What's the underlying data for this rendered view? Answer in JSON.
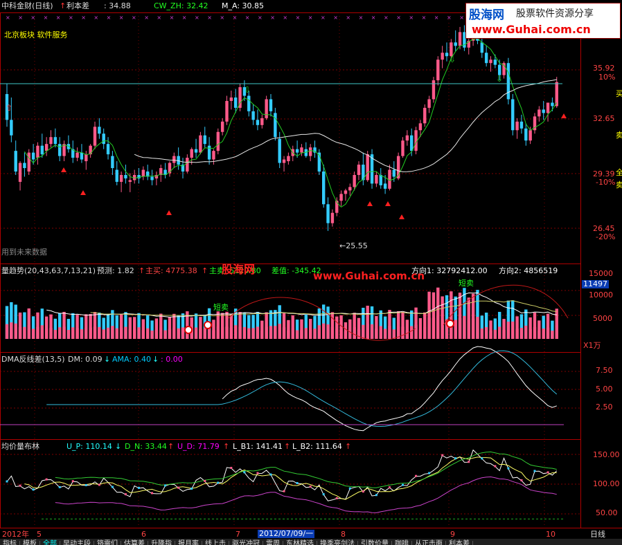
{
  "header": {
    "stock": "中科金财(日线)",
    "arrow": "↑",
    "indicator_name": "利本差",
    "val1_label": ": 34.88",
    "cw_label": "CW_ZH: 32.42",
    "ma_label": "M_A: 30.85",
    "subtitle": "北京板块 软件服务",
    "future_note": "用到未来数据"
  },
  "watermark": {
    "logo_cn": "股海网",
    "logo_tag": "股票软件资源分享",
    "logo_url": "www.Guhai.com.cn",
    "mid_cn": "股海网",
    "mid_url": "www.Guhai.com.cn"
  },
  "price_axis": {
    "ticks": [
      "35.92",
      "10%",
      "32.65",
      "29.39",
      "-10%",
      "26.45",
      "-20%"
    ],
    "low_marker": "←25.55",
    "side_chars": [
      "买",
      "卖",
      "全",
      "卖"
    ]
  },
  "vol_panel": {
    "title": "量趋势(20,43,63,7,13,21)",
    "forecast": "预测: 1.82",
    "up1": "↑",
    "main_buy": "主买: 4775.38",
    "up2": "↑",
    "main_sell": "主卖: 5120.80",
    "diff": "差值: -345.42",
    "dir1": "方向1: 32792412.00",
    "dir2": "方向2: 4856519",
    "ticks": [
      "15000",
      "10000",
      "5000"
    ],
    "current": "11497",
    "unit": "X1万",
    "signal1": "短卖",
    "signal2": "短卖"
  },
  "dma_panel": {
    "title": "DMA反线差(13,5)",
    "dm": "DM: 0.09",
    "dm_arrow": "↓",
    "ama": "AMA: 0.40",
    "ama_arrow": "↓",
    "third": ": 0.00",
    "ticks": [
      "7.50",
      "5.00",
      "2.50"
    ]
  },
  "boll_panel": {
    "title": "均价量布林",
    "up": "U_P: 110.14",
    "up_arrow": "↓",
    "dn": "D_N: 33.44",
    "dn_arrow": "↑",
    "ud": "U_D: 71.79",
    "ud_arrow": "↑",
    "lb1": "L_B1: 141.41",
    "lb1_arrow": "↑",
    "lb2": "L_B2: 111.64",
    "lb2_arrow": "↑",
    "ticks": [
      "150.00",
      "100.00",
      "50.00"
    ]
  },
  "date_axis": {
    "year": "2012年",
    "months": [
      "5",
      "6",
      "7",
      "8",
      "9",
      "10"
    ],
    "cursor_date": "2012/07/09/一",
    "period": "日线"
  },
  "tabs": [
    "指标",
    "模板",
    "全部",
    "早动主段",
    "铬需们",
    "估算差",
    "升降指",
    "报月率",
    "线上击",
    "驱光冲冠",
    "雷周",
    "东林精选",
    "换季亮剑法",
    "引数价量",
    "咖啡",
    "从正击面",
    "利本差"
  ],
  "colors": {
    "up": "#ff5a8a",
    "down": "#33ccff",
    "grid": "#800000",
    "axis": "#b00000"
  },
  "chart_data": {
    "type": "candlestick",
    "title": "中科金财(日线)",
    "ylim": [
      24.5,
      38.0
    ],
    "price_levels": [
      35.92,
      32.65,
      29.39,
      26.45
    ],
    "low_point": 25.55,
    "candles": [
      [
        33.5,
        34.1,
        31.6,
        32.0
      ],
      [
        32.0,
        33.3,
        30.7,
        31.1
      ],
      [
        30.2,
        30.8,
        28.8,
        29.0
      ],
      [
        28.4,
        29.6,
        27.9,
        29.5
      ],
      [
        29.5,
        30.1,
        28.7,
        29.2
      ],
      [
        29.0,
        30.3,
        28.8,
        30.1
      ],
      [
        30.1,
        30.6,
        29.4,
        29.7
      ],
      [
        29.8,
        30.7,
        29.4,
        30.5
      ],
      [
        30.5,
        31.2,
        29.8,
        30.0
      ],
      [
        30.2,
        31.0,
        29.9,
        30.6
      ],
      [
        30.6,
        31.4,
        30.4,
        31.0
      ],
      [
        31.0,
        31.5,
        30.4,
        30.6
      ],
      [
        30.6,
        31.0,
        29.6,
        29.9
      ],
      [
        29.9,
        30.8,
        29.6,
        30.6
      ],
      [
        30.6,
        31.1,
        30.1,
        30.3
      ],
      [
        30.3,
        30.8,
        29.5,
        29.8
      ],
      [
        29.8,
        30.4,
        29.6,
        30.1
      ],
      [
        30.1,
        30.6,
        29.5,
        29.7
      ],
      [
        29.6,
        30.2,
        29.1,
        30.0
      ],
      [
        30.0,
        30.6,
        29.8,
        30.5
      ],
      [
        30.5,
        31.9,
        30.3,
        31.6
      ],
      [
        31.6,
        32.1,
        30.9,
        31.2
      ],
      [
        31.2,
        31.5,
        30.3,
        30.6
      ],
      [
        30.6,
        31.0,
        29.7,
        30.0
      ],
      [
        29.9,
        30.2,
        28.8,
        29.2
      ],
      [
        29.1,
        29.6,
        28.2,
        28.4
      ],
      [
        28.4,
        29.0,
        27.8,
        28.8
      ],
      [
        28.8,
        29.4,
        28.3,
        28.6
      ],
      [
        28.4,
        28.9,
        27.8,
        28.5
      ],
      [
        28.5,
        29.1,
        28.3,
        28.8
      ],
      [
        28.8,
        29.2,
        28.3,
        28.6
      ],
      [
        28.7,
        29.3,
        28.5,
        29.1
      ],
      [
        29.0,
        29.4,
        28.5,
        28.7
      ],
      [
        28.7,
        29.1,
        28.2,
        28.5
      ],
      [
        28.6,
        29.0,
        28.2,
        28.8
      ],
      [
        28.8,
        29.4,
        28.4,
        29.2
      ],
      [
        29.1,
        29.5,
        28.6,
        28.8
      ],
      [
        28.9,
        29.6,
        28.7,
        29.5
      ],
      [
        29.5,
        30.1,
        29.2,
        29.9
      ],
      [
        29.9,
        30.4,
        29.1,
        29.4
      ],
      [
        29.4,
        29.8,
        28.6,
        29.0
      ],
      [
        29.0,
        30.0,
        28.9,
        29.8
      ],
      [
        29.8,
        30.4,
        29.4,
        30.3
      ],
      [
        30.3,
        30.9,
        29.8,
        30.1
      ],
      [
        30.1,
        31.3,
        30.0,
        31.1
      ],
      [
        31.1,
        31.6,
        30.4,
        30.6
      ],
      [
        30.5,
        31.0,
        29.4,
        29.7
      ],
      [
        29.7,
        30.3,
        29.4,
        30.2
      ],
      [
        30.2,
        31.5,
        30.0,
        31.3
      ],
      [
        31.3,
        32.1,
        31.1,
        31.9
      ],
      [
        31.9,
        33.4,
        31.7,
        33.1
      ],
      [
        33.1,
        33.7,
        32.6,
        33.3
      ],
      [
        33.3,
        33.8,
        32.4,
        32.7
      ],
      [
        32.7,
        34.1,
        32.5,
        33.9
      ],
      [
        33.9,
        34.3,
        33.1,
        33.4
      ],
      [
        33.4,
        33.7,
        32.2,
        32.5
      ],
      [
        32.5,
        32.9,
        31.7,
        32.0
      ],
      [
        32.0,
        32.6,
        31.4,
        31.7
      ],
      [
        31.7,
        32.3,
        31.5,
        32.1
      ],
      [
        32.1,
        33.4,
        32.0,
        33.2
      ],
      [
        33.2,
        33.5,
        32.2,
        32.5
      ],
      [
        32.4,
        32.7,
        30.8,
        31.0
      ],
      [
        30.9,
        31.3,
        29.2,
        29.5
      ],
      [
        29.5,
        29.9,
        29.0,
        29.7
      ],
      [
        29.6,
        30.1,
        29.4,
        29.9
      ],
      [
        29.9,
        30.5,
        29.6,
        30.3
      ],
      [
        30.3,
        30.8,
        29.8,
        30.1
      ],
      [
        30.1,
        30.6,
        29.9,
        30.4
      ],
      [
        30.3,
        30.7,
        29.8,
        29.9
      ],
      [
        29.9,
        30.6,
        29.6,
        30.4
      ],
      [
        30.4,
        30.8,
        29.8,
        30.1
      ],
      [
        30.1,
        30.3,
        28.8,
        29.0
      ],
      [
        29.0,
        29.4,
        26.9,
        27.1
      ],
      [
        27.1,
        27.5,
        25.55,
        26.0
      ],
      [
        26.0,
        26.8,
        25.8,
        26.6
      ],
      [
        26.6,
        27.5,
        26.4,
        27.3
      ],
      [
        27.3,
        27.9,
        27.0,
        27.7
      ],
      [
        27.7,
        28.0,
        27.3,
        27.9
      ],
      [
        27.9,
        28.3,
        27.6,
        28.1
      ],
      [
        28.1,
        29.0,
        27.9,
        28.8
      ],
      [
        28.8,
        29.6,
        28.5,
        29.4
      ],
      [
        29.4,
        30.1,
        28.2,
        28.5
      ],
      [
        28.5,
        30.2,
        28.4,
        30.0
      ],
      [
        30.0,
        30.3,
        28.0,
        28.3
      ],
      [
        28.3,
        29.0,
        28.1,
        28.8
      ],
      [
        28.8,
        29.2,
        28.0,
        28.2
      ],
      [
        28.3,
        28.8,
        27.7,
        28.0
      ],
      [
        28.0,
        29.4,
        27.9,
        29.1
      ],
      [
        29.1,
        29.6,
        28.4,
        28.7
      ],
      [
        28.6,
        30.1,
        28.5,
        29.9
      ],
      [
        29.9,
        31.0,
        29.8,
        30.8
      ],
      [
        30.8,
        31.4,
        30.5,
        31.1
      ],
      [
        31.1,
        31.5,
        29.9,
        30.2
      ],
      [
        30.2,
        31.6,
        30.0,
        31.4
      ],
      [
        31.4,
        32.0,
        31.0,
        31.8
      ],
      [
        31.8,
        32.9,
        31.6,
        32.7
      ],
      [
        32.7,
        33.4,
        32.4,
        33.2
      ],
      [
        33.2,
        34.5,
        33.0,
        34.3
      ],
      [
        34.3,
        35.7,
        34.0,
        35.5
      ],
      [
        35.5,
        36.3,
        35.0,
        35.9
      ],
      [
        35.9,
        36.5,
        35.4,
        35.7
      ],
      [
        35.7,
        36.7,
        35.5,
        36.5
      ],
      [
        36.5,
        37.2,
        36.0,
        36.3
      ],
      [
        36.3,
        37.4,
        36.1,
        37.1
      ],
      [
        37.1,
        37.5,
        36.0,
        36.2
      ],
      [
        36.2,
        36.8,
        35.8,
        36.6
      ],
      [
        36.6,
        37.4,
        36.3,
        37.2
      ],
      [
        37.2,
        37.6,
        36.4,
        36.6
      ],
      [
        36.5,
        36.8,
        35.6,
        35.9
      ],
      [
        35.9,
        36.3,
        35.1,
        35.3
      ],
      [
        35.3,
        35.7,
        34.8,
        35.5
      ],
      [
        35.5,
        35.8,
        35.0,
        35.2
      ],
      [
        35.2,
        35.5,
        34.3,
        34.6
      ],
      [
        34.6,
        35.4,
        34.4,
        35.3
      ],
      [
        35.3,
        35.6,
        32.9,
        33.2
      ],
      [
        33.2,
        33.5,
        31.1,
        31.4
      ],
      [
        31.4,
        32.1,
        30.9,
        31.9
      ],
      [
        31.9,
        32.3,
        31.2,
        31.5
      ],
      [
        31.5,
        31.8,
        30.5,
        30.8
      ],
      [
        30.8,
        31.6,
        30.6,
        31.4
      ],
      [
        31.4,
        32.4,
        31.2,
        32.2
      ],
      [
        32.2,
        32.8,
        31.9,
        32.6
      ],
      [
        32.6,
        33.1,
        32.0,
        32.4
      ],
      [
        32.4,
        32.9,
        31.9,
        33.0
      ],
      [
        33.0,
        33.3,
        32.5,
        32.8
      ],
      [
        32.8,
        34.5,
        32.7,
        34.2
      ]
    ]
  }
}
